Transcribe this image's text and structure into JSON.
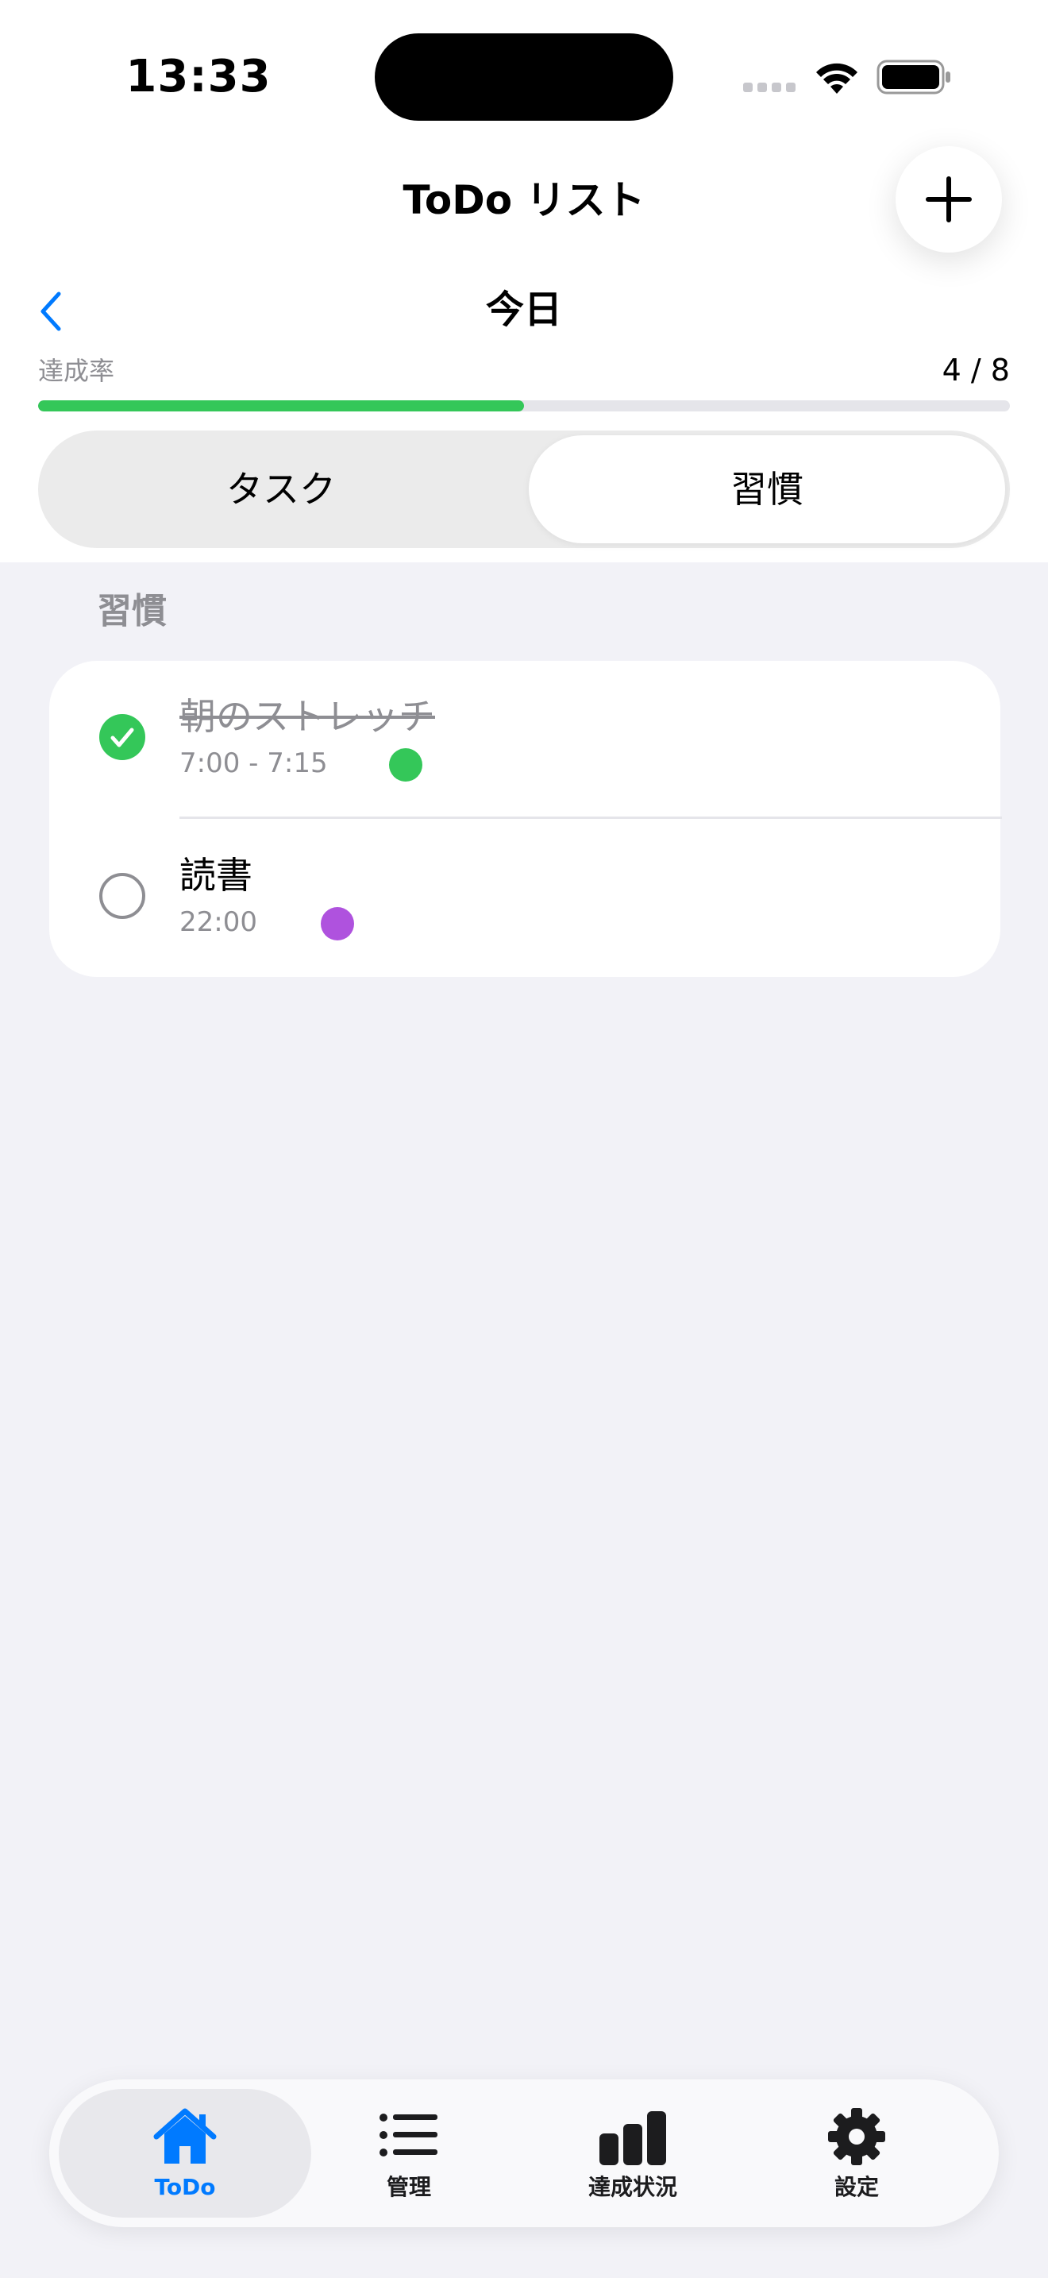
{
  "status_bar": {
    "time": "13:33"
  },
  "nav": {
    "title": "ToDo リスト",
    "add_icon": "plus-icon",
    "back_icon": "chevron-left-icon"
  },
  "day": {
    "title": "今日"
  },
  "progress": {
    "label": "達成率",
    "value_text": "4 / 8",
    "completed": 4,
    "total": 8,
    "color": "#34c759"
  },
  "segment": {
    "tabs": [
      {
        "label": "タスク",
        "selected": false
      },
      {
        "label": "習慣",
        "selected": true
      }
    ]
  },
  "section": {
    "header": "習慣"
  },
  "habits": [
    {
      "title": "朝のストレッチ",
      "time": "7:00 - 7:15",
      "done": true,
      "color": "#34c759"
    },
    {
      "title": "読書",
      "time": "22:00",
      "done": false,
      "color": "#af52de"
    }
  ],
  "tabbar": {
    "items": [
      {
        "label": "ToDo",
        "icon": "house-icon",
        "active": true
      },
      {
        "label": "管理",
        "icon": "list-icon",
        "active": false
      },
      {
        "label": "達成状況",
        "icon": "chart-icon",
        "active": false
      },
      {
        "label": "設定",
        "icon": "gear-icon",
        "active": false
      }
    ]
  },
  "colors": {
    "accent": "#007aff",
    "done": "#34c759",
    "background": "#f2f2f7"
  }
}
